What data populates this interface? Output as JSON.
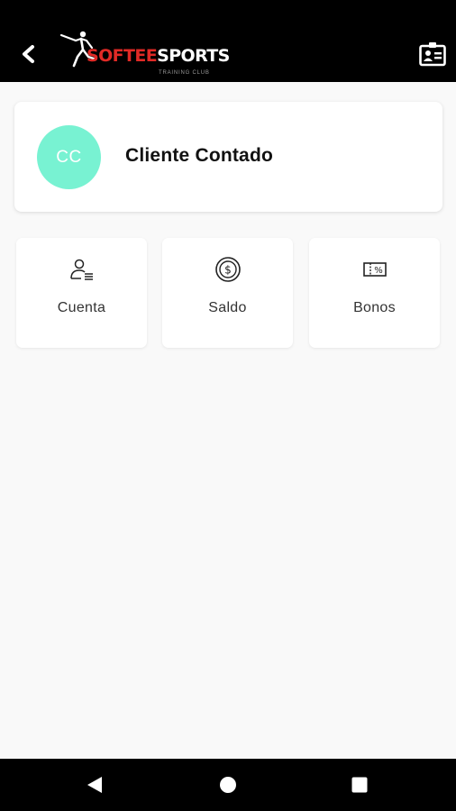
{
  "header": {
    "logo": {
      "brand_part1": "SOFTEE",
      "brand_part2": "SPORTS",
      "tagline": "TRAINING CLUB"
    },
    "back_icon": "back-arrow-icon",
    "id_card_icon": "id-card-icon"
  },
  "client": {
    "initials": "CC",
    "name": "Cliente Contado",
    "avatar_color": "#78f2d2"
  },
  "options": [
    {
      "label": "Cuenta",
      "icon": "user-list-icon"
    },
    {
      "label": "Saldo",
      "icon": "coin-dollar-icon"
    },
    {
      "label": "Bonos",
      "icon": "voucher-icon"
    }
  ],
  "nav": {
    "back": "nav-back-icon",
    "home": "nav-home-icon",
    "recents": "nav-recents-icon"
  },
  "colors": {
    "brand_red": "#e02a26",
    "app_bar": "#000000",
    "background": "#f9f9f9"
  }
}
